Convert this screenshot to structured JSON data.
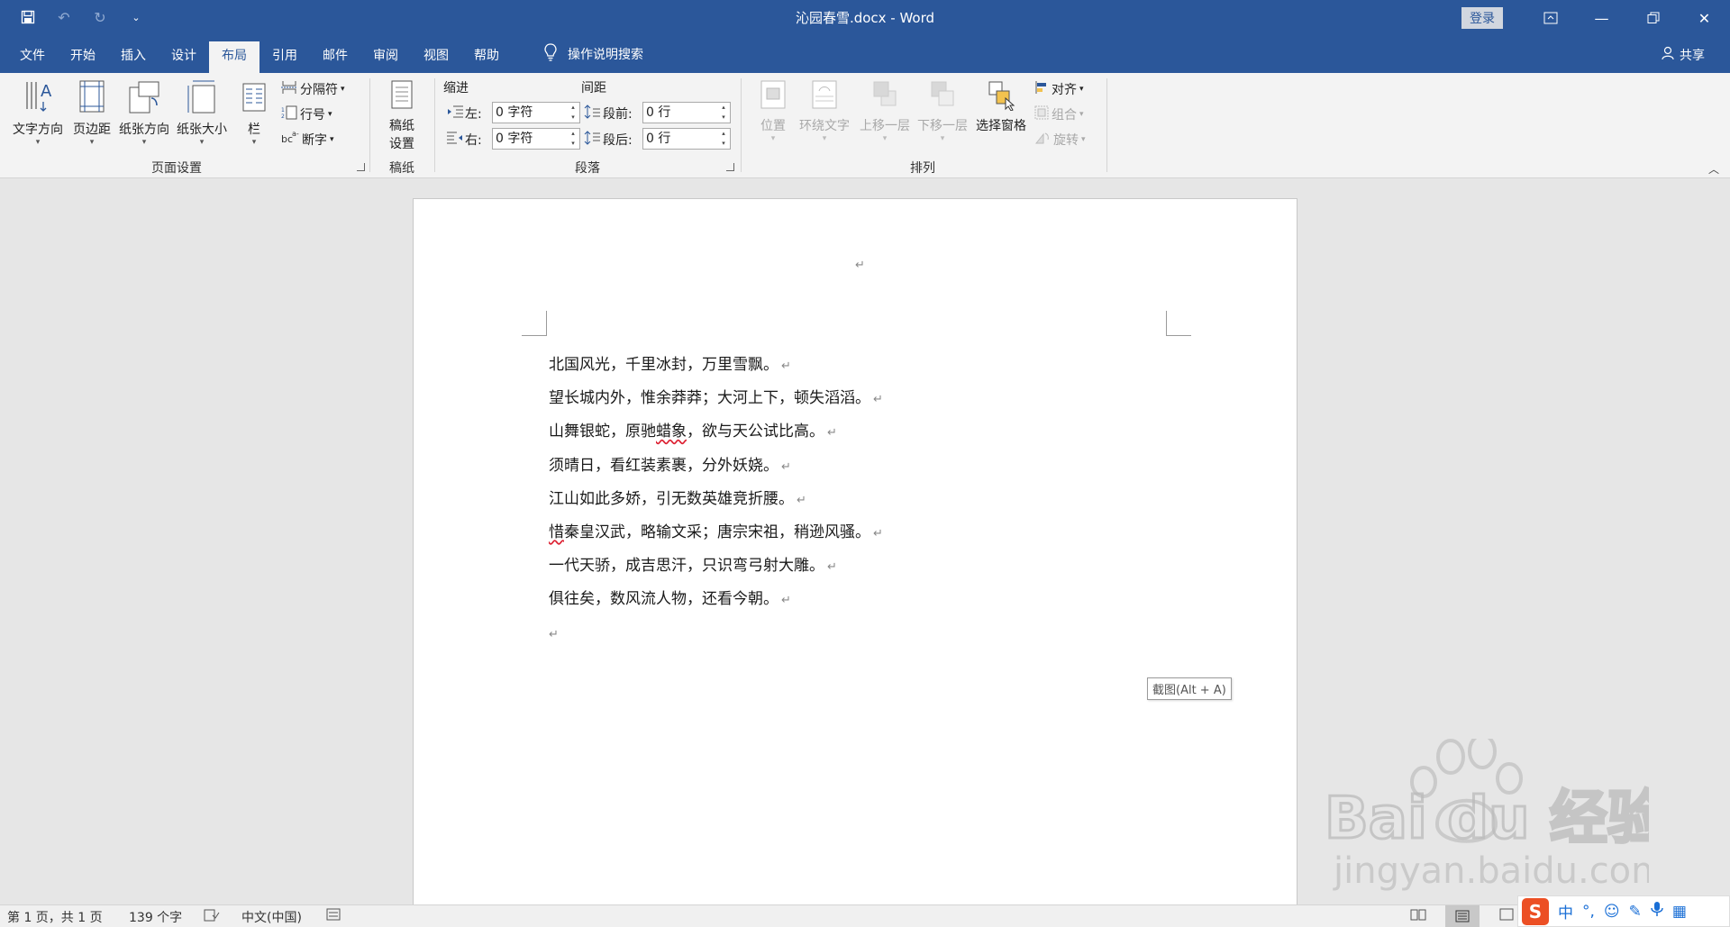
{
  "titlebar": {
    "title": "沁园春雪.docx  -  Word",
    "login_label": "登录"
  },
  "tabs": [
    {
      "label": "文件"
    },
    {
      "label": "开始"
    },
    {
      "label": "插入"
    },
    {
      "label": "设计"
    },
    {
      "label": "布局",
      "active": true
    },
    {
      "label": "引用"
    },
    {
      "label": "邮件"
    },
    {
      "label": "审阅"
    },
    {
      "label": "视图"
    },
    {
      "label": "帮助"
    }
  ],
  "tell_me": "操作说明搜索",
  "share": "共享",
  "ribbon": {
    "page_setup": {
      "label": "页面设置",
      "text_direction": "文字方向",
      "margins": "页边距",
      "orientation": "纸张方向",
      "size": "纸张大小",
      "columns": "栏",
      "breaks": "分隔符",
      "line_numbers": "行号",
      "hyphenation": "断字"
    },
    "manuscript": {
      "label": "稿纸",
      "settings_line1": "稿纸",
      "settings_line2": "设置"
    },
    "paragraph": {
      "label": "段落",
      "indent_title": "缩进",
      "spacing_title": "间距",
      "left_label": "左:",
      "left_value": "0 字符",
      "right_label": "右:",
      "right_value": "0 字符",
      "before_label": "段前:",
      "before_value": "0 行",
      "after_label": "段后:",
      "after_value": "0 行"
    },
    "arrange": {
      "label": "排列",
      "position": "位置",
      "wrap_text": "环绕文字",
      "bring_forward": "上移一层",
      "send_backward": "下移一层",
      "selection_pane": "选择窗格",
      "align": "对齐",
      "group": "组合",
      "rotate": "旋转"
    }
  },
  "document": {
    "lines": [
      "北国风光，千里冰封，万里雪飘。",
      "望长城内外，惟余莽莽；大河上下，顿失滔滔。",
      "山舞银蛇，原驰蜡象，欲与天公试比高。",
      "须晴日，看红装素裹，分外妖娆。",
      "江山如此多娇，引无数英雄竞折腰。",
      "惜秦皇汉武，略输文采；唐宗宋祖，稍逊风骚。",
      "一代天骄，成吉思汗，只识弯弓射大雕。",
      "俱往矣，数风流人物，还看今朝。",
      ""
    ],
    "para_mark": "↵",
    "tooltip": "截图(Alt + A)"
  },
  "watermark": {
    "text": "Bai du 经验",
    "url": "jingyan.baidu.com"
  },
  "status": {
    "page": "第 1 页，共 1 页",
    "words": "139 个字",
    "language": "中文(中国)"
  },
  "ime": {
    "logo": "S",
    "mode": "中"
  }
}
